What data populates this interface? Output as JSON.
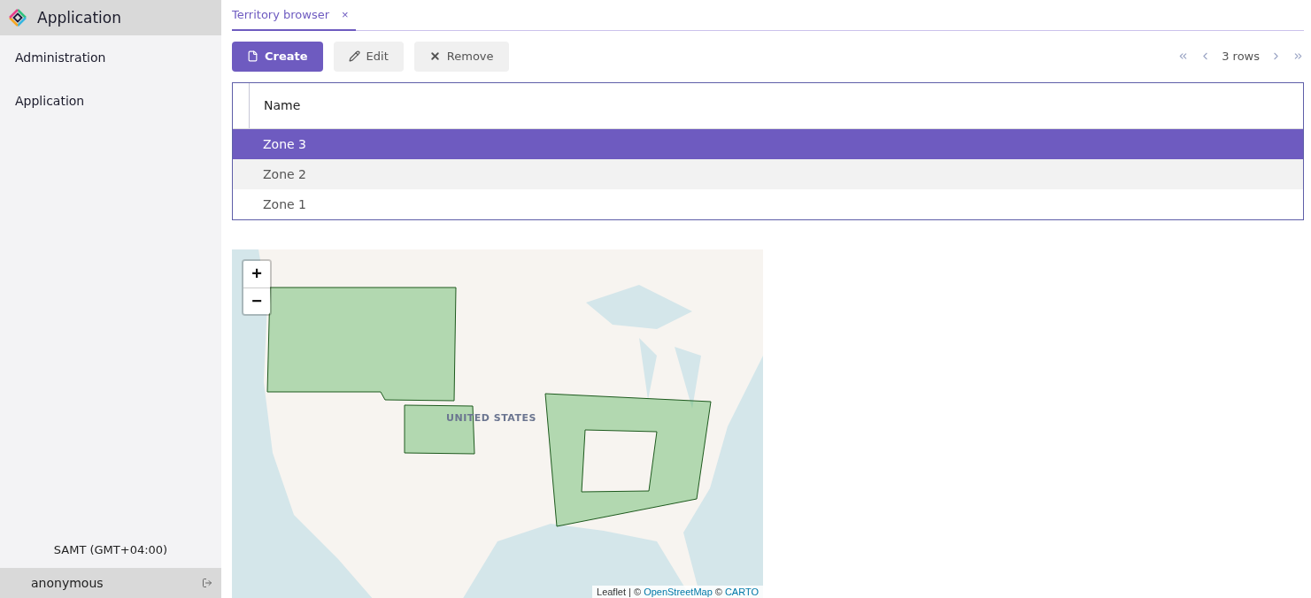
{
  "app": {
    "title": "Application"
  },
  "sidebar": {
    "items": [
      {
        "label": "Administration"
      },
      {
        "label": "Application"
      }
    ],
    "timezone": "SAMT (GMT+04:00)",
    "user": "anonymous"
  },
  "tabs": [
    {
      "label": "Territory browser",
      "selected": true,
      "close": "×"
    }
  ],
  "toolbar": {
    "buttons": [
      {
        "label": "Create",
        "kind": "primary"
      },
      {
        "label": "Edit",
        "kind": "edit"
      },
      {
        "label": "Remove",
        "kind": "remove"
      }
    ],
    "pagination": {
      "count": "3 rows"
    }
  },
  "table": {
    "columns": [
      "Name"
    ],
    "rows": [
      {
        "name": "Zone 3",
        "selected": true
      },
      {
        "name": "Zone 2",
        "selected": false
      },
      {
        "name": "Zone 1",
        "selected": false
      }
    ]
  },
  "map": {
    "label": "UNITED STATES",
    "zoom_in": "+",
    "zoom_out": "−",
    "attribution": [
      {
        "kind": "text",
        "text": "Leaflet | ©"
      },
      {
        "kind": "link",
        "text": "OpenStreetMap"
      },
      {
        "kind": "text",
        "text": "©"
      },
      {
        "kind": "link",
        "text": "CARTO"
      }
    ]
  }
}
